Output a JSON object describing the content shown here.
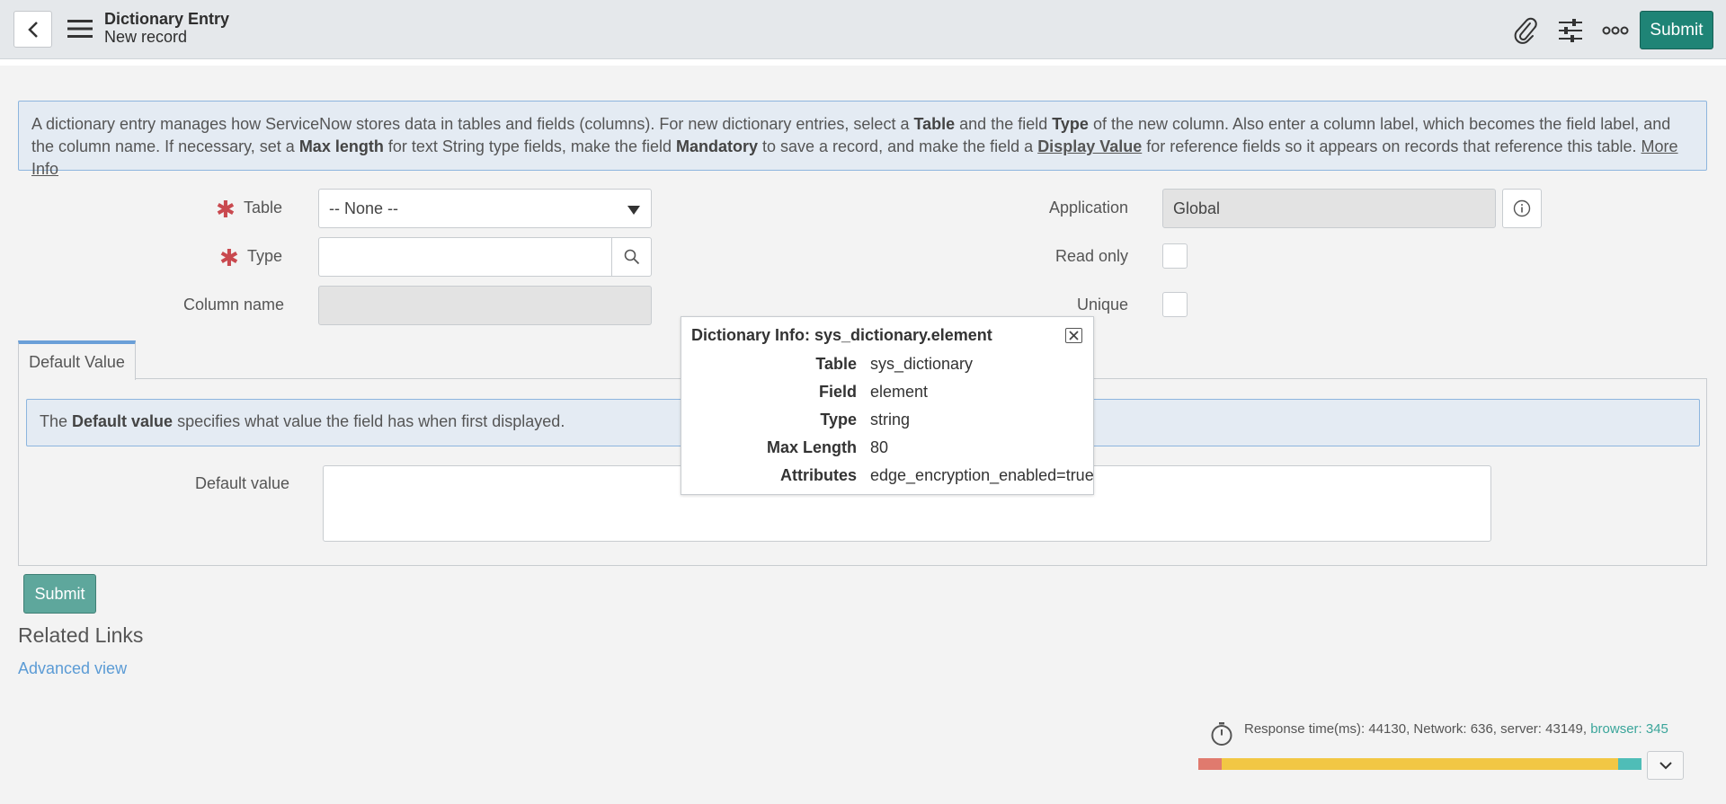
{
  "header": {
    "title": "Dictionary Entry",
    "subtitle": "New record",
    "submit_label": "Submit"
  },
  "info_banner": {
    "p1": "A dictionary entry manages how ServiceNow stores data in tables and fields (columns). For new dictionary entries, select a ",
    "b1": "Table",
    "p2": " and the field ",
    "b2": "Type",
    "p3": " of the new column. Also enter a column label, which becomes the field label, and the column name. If necessary, set a ",
    "b3": "Max length",
    "p4": " for text String type fields, make the field ",
    "b4": "Mandatory",
    "p5": " to save a record, and make the field a ",
    "b5": "Display Value",
    "p6": " for reference fields so it appears on records that reference this table. ",
    "more_info": "More Info"
  },
  "form": {
    "table_label": "Table",
    "table_value": "-- None --",
    "type_label": "Type",
    "type_value": "",
    "column_name_label": "Column name",
    "application_label": "Application",
    "application_value": "Global",
    "read_only_label": "Read only",
    "unique_label": "Unique"
  },
  "tab": {
    "label": "Default Value",
    "info_pre": "The ",
    "info_bold": "Default value",
    "info_post": " specifies what value the field has when first displayed.",
    "default_value_label": "Default value"
  },
  "bottom": {
    "submit_label": "Submit",
    "related_links_title": "Related Links",
    "advanced_view_link": "Advanced view"
  },
  "popup": {
    "title": "Dictionary Info: sys_dictionary.element",
    "rows": [
      {
        "key": "Table",
        "value": "sys_dictionary"
      },
      {
        "key": "Field",
        "value": "element"
      },
      {
        "key": "Type",
        "value": "string"
      },
      {
        "key": "Max Length",
        "value": "80"
      },
      {
        "key": "Attributes",
        "value": "edge_encryption_enabled=true"
      }
    ]
  },
  "response": {
    "text": "Response time(ms): 44130, Network: 636, server: 43149, ",
    "browser": "browser: 345",
    "segments": [
      {
        "name": "network",
        "value": 636,
        "color": "#e07a6e"
      },
      {
        "name": "server",
        "value": 43149,
        "color": "#f2c744"
      },
      {
        "name": "browser",
        "value": 345,
        "color": "#4fbdb7"
      }
    ]
  },
  "colors": {
    "accent": "#1f8476",
    "required": "#c9494f",
    "link": "#5b9bd5"
  }
}
